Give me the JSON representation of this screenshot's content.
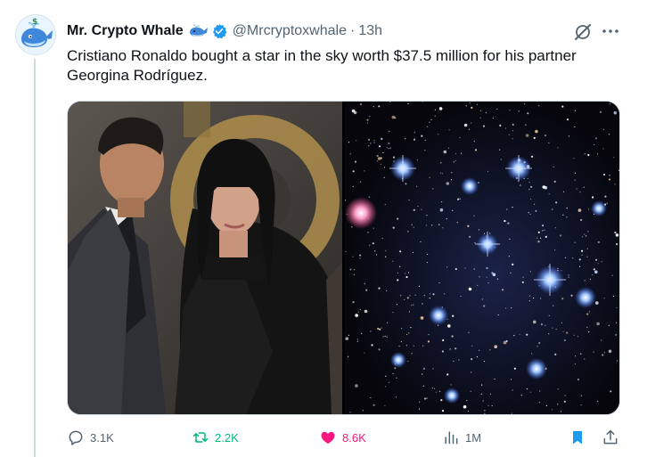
{
  "author": {
    "name": "Mr. Crypto Whale",
    "handle": "@Mrcryptoxwhale",
    "separator": "·",
    "time": "13h",
    "verified": true
  },
  "tweet": {
    "text": "Cristiano Ronaldo bought a star in the sky worth $37.5 million for his partner Georgina Rodríguez."
  },
  "media": {
    "images": [
      {
        "name": "couple-photo"
      },
      {
        "name": "star-field-photo"
      }
    ]
  },
  "actions": {
    "replies": "3.1K",
    "retweets": "2.2K",
    "likes": "8.6K",
    "views": "1M"
  },
  "colors": {
    "accent": "#1d9bf0",
    "retweet": "#00ba7c",
    "like": "#f91880",
    "muted": "#536471"
  },
  "icons": [
    "grok-icon",
    "more-icon",
    "reply-icon",
    "retweet-icon",
    "heart-icon",
    "views-icon",
    "bookmark-icon",
    "share-icon",
    "verified-badge-icon",
    "whale-emoji-icon"
  ]
}
